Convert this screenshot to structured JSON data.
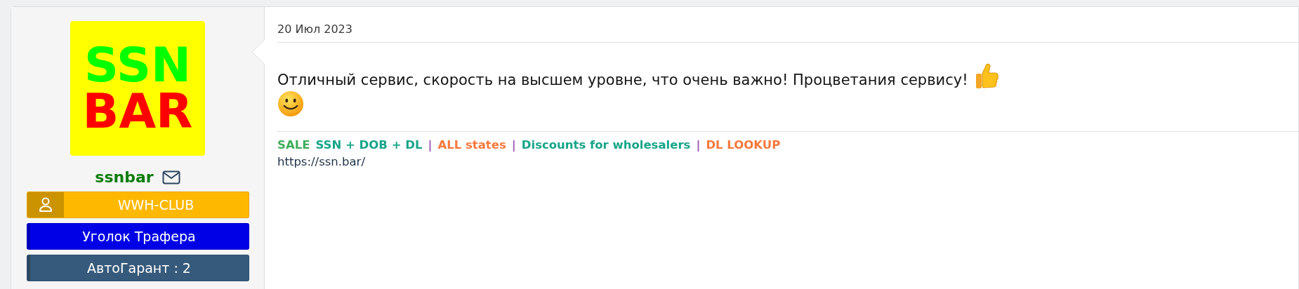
{
  "user": {
    "avatar_lines": [
      {
        "text": "SSN",
        "color": "#00ff00"
      },
      {
        "text": "BAR",
        "color": "#ff0000"
      }
    ],
    "name": "ssnbar",
    "badges": [
      {
        "kind": "icon",
        "label": "WWH-CLUB",
        "color": "#ffb800"
      },
      {
        "kind": "plain",
        "label": "Уголок Трафера",
        "color": "#0000e6"
      },
      {
        "kind": "plain",
        "label": "АвтоГарант : 2",
        "color": "#365a7b"
      }
    ]
  },
  "post": {
    "date": "20 Июл 2023",
    "message": "Отличный сервис, скорость на высшем уровне, что очень важно! Процветания сервису!",
    "signature": [
      {
        "text": "SALE",
        "color": "#3fae5a"
      },
      {
        "text": "SSN + DOB + DL",
        "color": "#17a589"
      },
      {
        "text": "|",
        "color": "#9b59b6"
      },
      {
        "text": "ALL states",
        "color": "#f5793b"
      },
      {
        "text": "|",
        "color": "#9b59b6"
      },
      {
        "text": "Discounts for wholesalers",
        "color": "#17a589"
      },
      {
        "text": "|",
        "color": "#9b59b6"
      },
      {
        "text": "DL LOOKUP",
        "color": "#f5793b"
      }
    ],
    "url": "https://ssn.bar/"
  }
}
